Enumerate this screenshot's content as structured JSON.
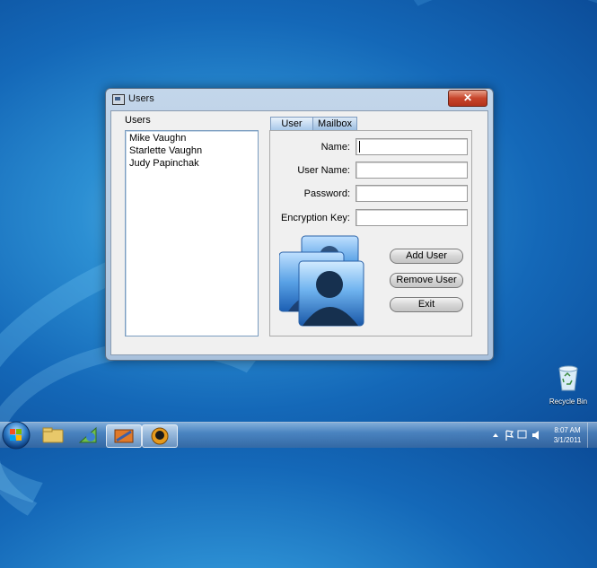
{
  "window": {
    "title": "Users",
    "close_label": "✕",
    "users_label": "Users",
    "users": [
      "Mike Vaughn",
      "Starlette Vaughn",
      "Judy Papinchak"
    ],
    "tabs": [
      "User",
      "Mailbox"
    ],
    "fields": {
      "name": {
        "label": "Name:",
        "value": ""
      },
      "username": {
        "label": "User Name:",
        "value": ""
      },
      "password": {
        "label": "Password:",
        "value": ""
      },
      "encryption": {
        "label": "Encryption Key:",
        "value": ""
      }
    },
    "buttons": {
      "add": "Add User",
      "remove": "Remove User",
      "exit": "Exit"
    }
  },
  "desktop": {
    "recycle_bin_label": "Recycle Bin"
  },
  "taskbar": {
    "time": "8:07 AM",
    "date": "3/1/2011",
    "tray_icons": [
      "up-arrow-icon",
      "flag-icon",
      "network-icon",
      "speaker-icon"
    ]
  },
  "colors": {
    "titlebar": "#b9cfe6",
    "close": "#c7452b",
    "tab": "#a8c8ea"
  }
}
